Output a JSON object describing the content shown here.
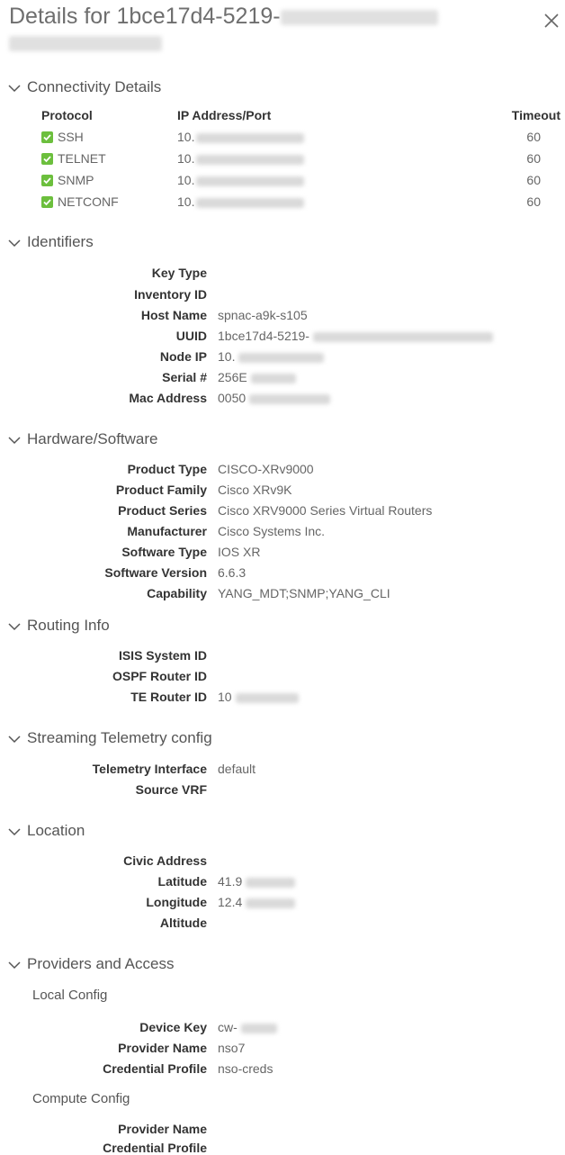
{
  "title_prefix": "Details for 1bce17d4-5219-",
  "close_icon": "close-icon",
  "sections": {
    "connectivity": "Connectivity Details",
    "identifiers": "Identifiers",
    "hardware": "Hardware/Software",
    "routing": "Routing Info",
    "telemetry": "Streaming Telemetry config",
    "location": "Location",
    "providers": "Providers and Access"
  },
  "connectivity": {
    "headers": {
      "protocol": "Protocol",
      "ip": "IP Address/Port",
      "timeout": "Timeout"
    },
    "rows": [
      {
        "protocol": "SSH",
        "ip": "10.",
        "timeout": "60"
      },
      {
        "protocol": "TELNET",
        "ip": "10.",
        "timeout": "60"
      },
      {
        "protocol": "SNMP",
        "ip": "10.",
        "timeout": "60"
      },
      {
        "protocol": "NETCONF",
        "ip": "10.",
        "timeout": "60"
      }
    ]
  },
  "identifiers": {
    "key_type": {
      "label": "Key Type",
      "value": ""
    },
    "inventory_id": {
      "label": "Inventory ID",
      "value": ""
    },
    "host_name": {
      "label": "Host Name",
      "value": "spnac-a9k-s105"
    },
    "uuid": {
      "label": "UUID",
      "value": "1bce17d4-5219-"
    },
    "node_ip": {
      "label": "Node IP",
      "value": "10."
    },
    "serial": {
      "label": "Serial #",
      "value": "256E"
    },
    "mac": {
      "label": "Mac Address",
      "value": "0050"
    }
  },
  "hardware": {
    "product_type": {
      "label": "Product Type",
      "value": "CISCO-XRv9000"
    },
    "product_family": {
      "label": "Product Family",
      "value": "Cisco XRv9K"
    },
    "product_series": {
      "label": "Product Series",
      "value": "Cisco XRV9000 Series Virtual Routers"
    },
    "manufacturer": {
      "label": "Manufacturer",
      "value": "Cisco Systems Inc."
    },
    "software_type": {
      "label": "Software Type",
      "value": "IOS XR"
    },
    "software_version": {
      "label": "Software Version",
      "value": "6.6.3"
    },
    "capability": {
      "label": "Capability",
      "value": "YANG_MDT;SNMP;YANG_CLI"
    }
  },
  "routing": {
    "isis": {
      "label": "ISIS System ID",
      "value": ""
    },
    "ospf": {
      "label": "OSPF Router ID",
      "value": ""
    },
    "te": {
      "label": "TE Router ID",
      "value": "10"
    }
  },
  "telemetry": {
    "interface": {
      "label": "Telemetry Interface",
      "value": "default"
    },
    "vrf": {
      "label": "Source VRF",
      "value": ""
    }
  },
  "location": {
    "civic": {
      "label": "Civic Address",
      "value": ""
    },
    "latitude": {
      "label": "Latitude",
      "value": "41.9"
    },
    "longitude": {
      "label": "Longitude",
      "value": "12.4"
    },
    "altitude": {
      "label": "Altitude",
      "value": ""
    }
  },
  "providers": {
    "local_config": "Local Config",
    "device_key": {
      "label": "Device Key",
      "value": "cw-"
    },
    "provider_name": {
      "label": "Provider Name",
      "value": "nso7"
    },
    "credential_profile": {
      "label": "Credential Profile",
      "value": "nso-creds"
    },
    "compute_config": "Compute Config",
    "compute_provider_name": {
      "label": "Provider Name",
      "value": ""
    },
    "compute_credential_profile": {
      "label": "Credential Profile",
      "value": ""
    }
  }
}
